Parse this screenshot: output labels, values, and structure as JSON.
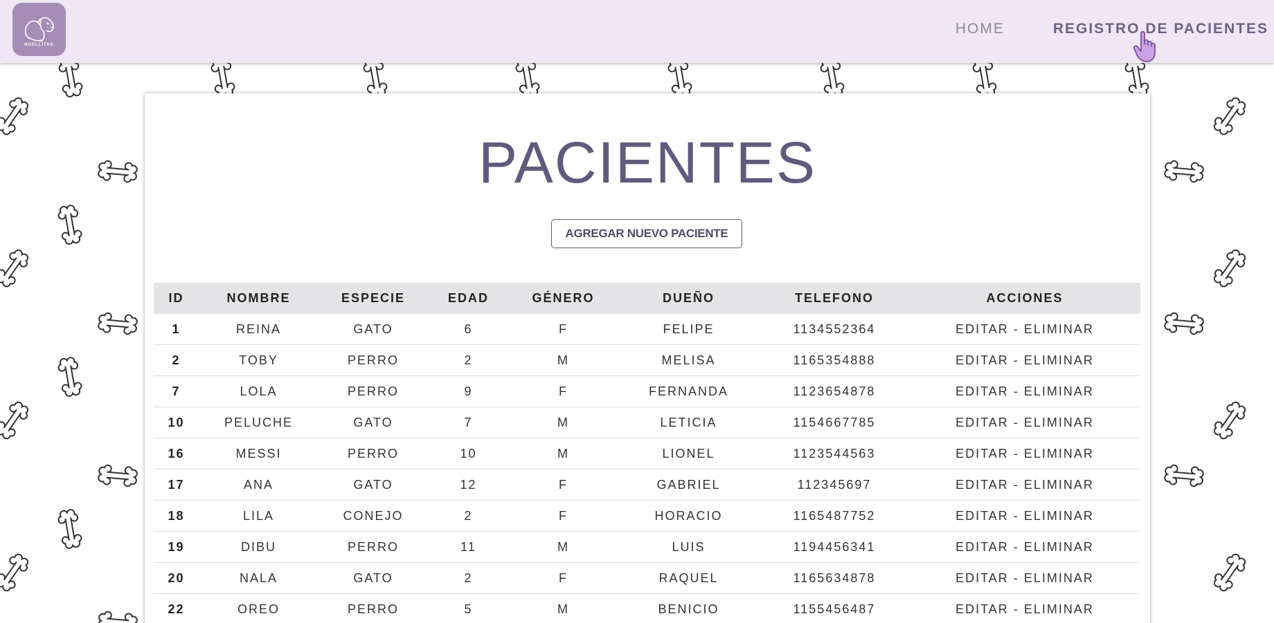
{
  "brand": {
    "logo_text": "HUELLITAS"
  },
  "nav": {
    "home_label": "HOME",
    "registro_label": "REGISTRO DE PACIENTES"
  },
  "main": {
    "title": "PACIENTES",
    "add_button_label": "AGREGAR NUEVO PACIENTE"
  },
  "table": {
    "headers": [
      "ID",
      "NOMBRE",
      "ESPECIE",
      "EDAD",
      "GÉNERO",
      "DUEÑO",
      "TELEFONO",
      "ACCIONES"
    ],
    "action_edit": "EDITAR",
    "action_separator": " - ",
    "action_delete": "ELIMINAR",
    "rows": [
      [
        "1",
        "REINA",
        "GATO",
        "6",
        "F",
        "FELIPE",
        "1134552364"
      ],
      [
        "2",
        "TOBY",
        "PERRO",
        "2",
        "M",
        "MELISA",
        "1165354888"
      ],
      [
        "7",
        "LOLA",
        "PERRO",
        "9",
        "F",
        "FERNANDA",
        "1123654878"
      ],
      [
        "10",
        "PELUCHE",
        "GATO",
        "7",
        "M",
        "LETICIA",
        "1154667785"
      ],
      [
        "16",
        "MESSI",
        "PERRO",
        "10",
        "M",
        "LIONEL",
        "1123544563"
      ],
      [
        "17",
        "ANA",
        "GATO",
        "12",
        "F",
        "GABRIEL",
        "112345697"
      ],
      [
        "18",
        "LILA",
        "CONEJO",
        "2",
        "F",
        "HORACIO",
        "1165487752"
      ],
      [
        "19",
        "DIBU",
        "PERRO",
        "11",
        "M",
        "LUIS",
        "1194456341"
      ],
      [
        "20",
        "NALA",
        "GATO",
        "2",
        "F",
        "RAQUEL",
        "1165634878"
      ],
      [
        "22",
        "OREO",
        "PERRO",
        "5",
        "M",
        "BENICIO",
        "1155456487"
      ]
    ]
  },
  "colors": {
    "navbar_bg": "#efe7f5",
    "logo_bg": "#a58db6",
    "title_color": "#625a7d",
    "header_row_bg": "#e4e4e6"
  }
}
